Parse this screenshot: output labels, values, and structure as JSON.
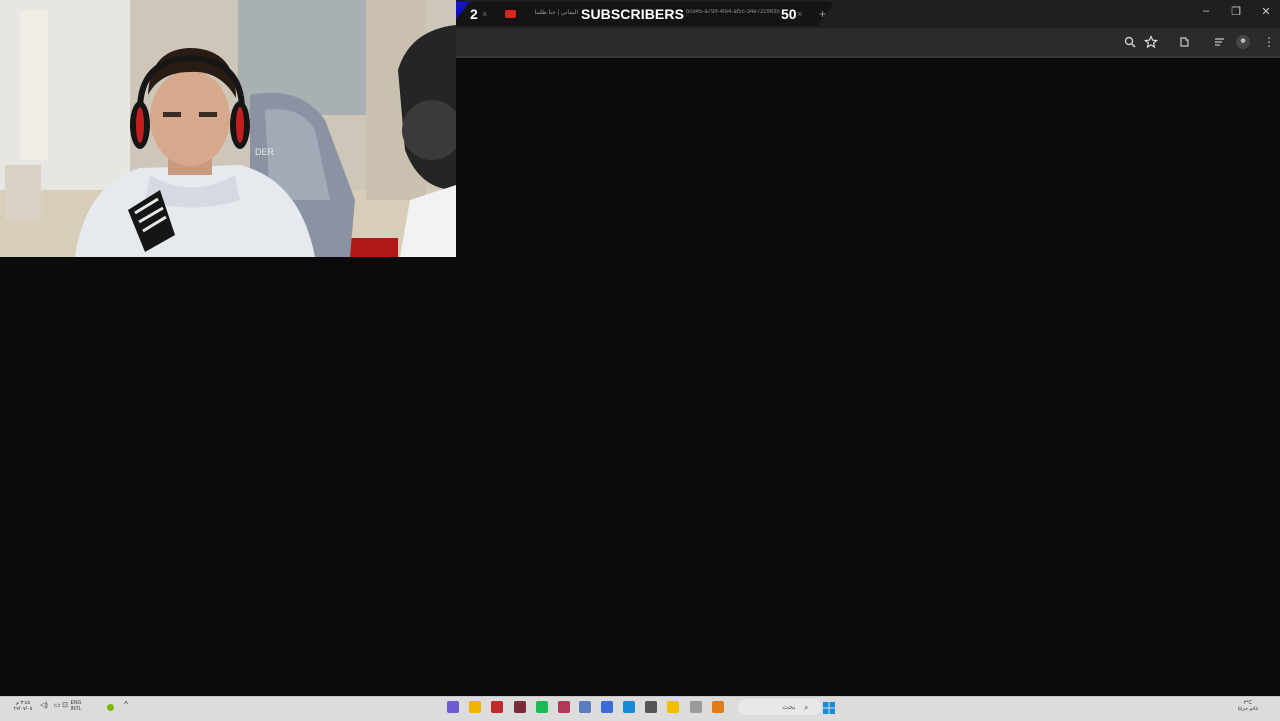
{
  "overlay": {
    "left_count": "2",
    "label": "SUBSCRIBERS",
    "right_count": "50"
  },
  "tabs": [
    {
      "title": "اليماني | حنا طلبنا",
      "close": "×"
    },
    {
      "title": "bce45-a798-4fe4-af5c-34e72c9835",
      "close": "×"
    }
  ],
  "tab_close_first": "×",
  "new_tab": "+",
  "window": {
    "minimize": "–",
    "maximize": "❐",
    "close": "✕"
  },
  "toolbar_icons": [
    "zoom-icon",
    "bookmark-star-icon",
    "extensions-icon",
    "reading-list-icon",
    "profile-avatar",
    "menu-icon"
  ],
  "menu_glyph": "⋮",
  "taskbar": {
    "clock_time": "٣:٤٥ م",
    "clock_date": "٢٧/٠٧/٠٥",
    "lang_primary": "ENG",
    "lang_secondary": "INTL",
    "search_text": "بحث",
    "weather_temp": "٣°C",
    "weather_desc": "غائم جزئيًا"
  },
  "taskbar_icons": [
    {
      "name": "discord-taskbar-icon",
      "color": "#6d5bd0"
    },
    {
      "name": "warning-taskbar-icon",
      "color": "#f2b400"
    },
    {
      "name": "obs-taskbar-icon",
      "color": "#c22a2a"
    },
    {
      "name": "terminal-taskbar-icon",
      "color": "#7a2b3a"
    },
    {
      "name": "spotify-taskbar-icon",
      "color": "#1db954"
    },
    {
      "name": "app-pink-taskbar-icon",
      "color": "#b03a5a"
    },
    {
      "name": "settings-taskbar-icon",
      "color": "#5a7bbd"
    },
    {
      "name": "snip-taskbar-icon",
      "color": "#3a6bd8"
    },
    {
      "name": "edge-taskbar-icon",
      "color": "#1a8ad8"
    },
    {
      "name": "store-taskbar-icon",
      "color": "#555555"
    },
    {
      "name": "file-explorer-taskbar-icon",
      "color": "#f3c000"
    },
    {
      "name": "notes-taskbar-icon",
      "color": "#9a9a9a"
    },
    {
      "name": "widgets-taskbar-icon",
      "color": "#e07a1a"
    }
  ],
  "colors": {
    "tabstrip": "#1f1f1f",
    "toolbar": "#2b2b2b",
    "page_bg": "#0b0b0b",
    "overlay_accent": "#2a2aff",
    "taskbar": "#dcdcdc"
  }
}
